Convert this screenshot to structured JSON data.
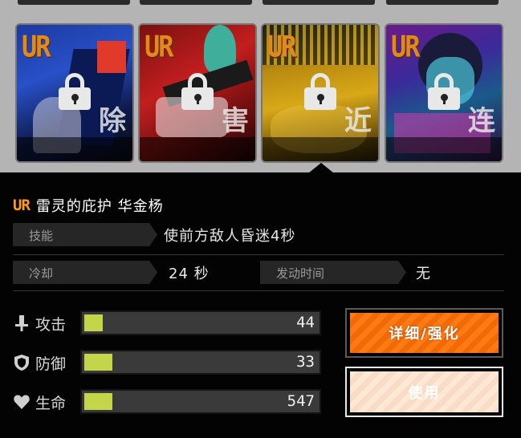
{
  "cards": [
    {
      "rarity": "UR",
      "kanji": "除",
      "locked": true
    },
    {
      "rarity": "UR",
      "kanji": "害",
      "locked": true
    },
    {
      "rarity": "UR",
      "kanji": "近",
      "locked": true
    },
    {
      "rarity": "UR",
      "kanji": "连",
      "locked": true
    }
  ],
  "detail": {
    "rarity": "UR",
    "title": "雷灵的庇护 华金杨",
    "skill_label": "技能",
    "skill_value": "使前方敌人昏迷4秒",
    "cooldown_label": "冷却",
    "cooldown_value": "24 秒",
    "activation_label": "发动时间",
    "activation_value": "无"
  },
  "stats": [
    {
      "icon": "sword-icon",
      "label": "攻击",
      "value": "44",
      "fill_fraction": 0.08
    },
    {
      "icon": "shield-icon",
      "label": "防御",
      "value": "33",
      "fill_fraction": 0.12
    },
    {
      "icon": "heart-icon",
      "label": "生命",
      "value": "547",
      "fill_fraction": 0.12
    }
  ],
  "buttons": {
    "detail_label": "详细/强化",
    "use_label": "使用"
  },
  "colors": {
    "accent_orange": "#ff7a12",
    "rarity_orange": "#ff9a1a",
    "stat_bar_fill": "#c3d64a"
  }
}
